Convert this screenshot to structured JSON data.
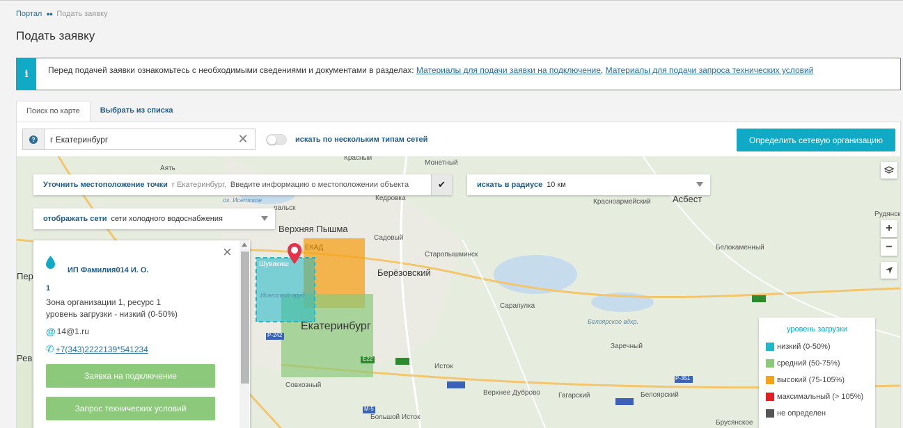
{
  "breadcrumb": {
    "home": "Портал",
    "separator": "●●",
    "current": "Подать заявку"
  },
  "page_title": "Подать заявку",
  "info": {
    "icon": "info-icon",
    "text": "Перед подачей заявки ознакомьтесь с необходимыми сведениями и документами в разделах: ",
    "link1": "Материалы для подачи заявки на подключение",
    "comma": ", ",
    "link2": "Материалы для подачи запроса технических условий"
  },
  "tabs": [
    {
      "label": "Поиск по карте",
      "active": true
    },
    {
      "label": "Выбрать из списка",
      "active": false
    }
  ],
  "search": {
    "value": "г Екатеринбург",
    "help_icon": "?",
    "clear_icon": "close-icon"
  },
  "toggle": {
    "label": "искать по нескольким типам сетей",
    "on": false
  },
  "determine_button": "Определить сетевую организацию",
  "map_controls": {
    "location": {
      "label": "Уточнить местоположение точки",
      "city": "г Екатеринбург,",
      "placeholder": "Введите информацию о местоположении объекта",
      "check": "✔"
    },
    "radius": {
      "label": "искать в радиусе",
      "value": "10 км"
    },
    "networks": {
      "label": "отображать сети",
      "value": "сети холодного водоснабжения"
    }
  },
  "map_labels": {
    "arti": "Аять",
    "krasny": "Красный",
    "monetny": "Монетный",
    "kedrovka": "Кедровка",
    "krasnoarmeysky": "Красноармейский",
    "asbest": "Асбест",
    "rudyansky": "Рудянск",
    "iset_lake": "оз. Исетское",
    "uralsk": "ральск",
    "v_pyshma": "Верхняя Пышма",
    "sadovy": "Садовый",
    "staropyshminsk": "Старопышминск",
    "belokamenny": "Белокаменный",
    "berezovsky": "Берёзовский",
    "ekad": "ЕКАД",
    "sarapulka": "Сарапулка",
    "beloyarskoe": "Белоярское вдхр.",
    "ekaterinburg": "Екатеринбург",
    "shuvakish": "Шувакиш",
    "isetsky_prud": "Исетский пруд",
    "zarechny": "Заречный",
    "istok": "Исток",
    "sovkhozny": "Совхозный",
    "v_dubrovo": "Верхнее Дуброво",
    "gagarsky": "Гагарский",
    "beloyarsky": "Белоярский",
    "bolshoy_istok": "Большой Исток",
    "brusyanskoe": "Брусянское",
    "perv": "Перв",
    "rev": "Рев",
    "r242": "Р-242",
    "r351": "Р-351",
    "e22": "Е22",
    "m5": "М-5"
  },
  "zone_popup": {
    "org_name": "ИП Фамилия014 И. О.",
    "zone_number": "1",
    "zone_desc": "Зона организации 1, ресурс 1",
    "load_level": "уровень загрузки - низкий (0-50%)",
    "email": "14@1.ru",
    "email_icon": "@",
    "phone": "+7(343)2222139*541234",
    "phone_icon": "phone-icon",
    "btn_connect": "Заявка на подключение",
    "btn_tech": "Запрос технических условий",
    "close_icon": "×"
  },
  "map_buttons": {
    "layers": "layers-icon",
    "zoom_in": "+",
    "zoom_out": "−",
    "locate": "locate-icon"
  },
  "legend": {
    "title": "уровень загрузки",
    "items": [
      {
        "label": "низкий (0-50%)",
        "color": "#1eb8c7"
      },
      {
        "label": "средний (50-75%)",
        "color": "#8cc97a"
      },
      {
        "label": "высокий (75-105%)",
        "color": "#f5a21b"
      },
      {
        "label": "максимальный (> 105%)",
        "color": "#e02020"
      },
      {
        "label": "не определен",
        "color": "#555555"
      }
    ]
  },
  "colors": {
    "accent": "#10a9c6",
    "link": "#1f5c87",
    "green_button": "#8cc97a"
  }
}
